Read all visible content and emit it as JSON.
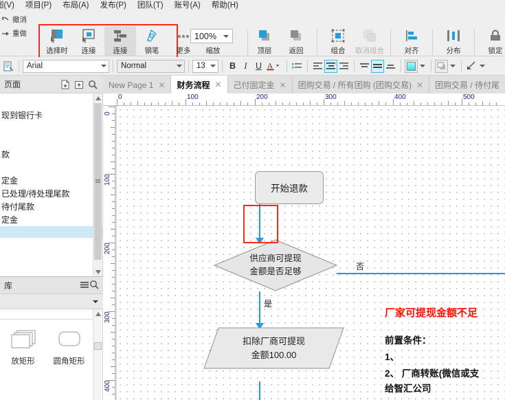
{
  "menubar": {
    "items": [
      "图(V)",
      "项目(P)",
      "布局(A)",
      "发布(P)",
      "团队(T)",
      "账号(A)",
      "帮助(H)"
    ]
  },
  "ribbon": {
    "undo_label": "撤消",
    "redo_label": "重做",
    "buttons": [
      {
        "label": "选择时",
        "icon": "select-tool-icon",
        "dim": false
      },
      {
        "label": "连接",
        "icon": "connector-icon",
        "dim": false
      },
      {
        "label": "钢笔",
        "icon": "pen-icon",
        "dim": false
      },
      {
        "label": "更多",
        "icon": "more-dots-icon",
        "dim": false
      }
    ],
    "zoom": {
      "value": "100%",
      "label": "缩放"
    },
    "arrange": [
      {
        "label": "顶层",
        "icon": "bring-to-front-icon",
        "dim": false
      },
      {
        "label": "返回",
        "icon": "send-to-back-icon",
        "dim": false
      },
      {
        "label": "组合",
        "icon": "group-icon",
        "dim": false
      },
      {
        "label": "取消组合",
        "icon": "ungroup-icon",
        "dim": true
      },
      {
        "label": "对齐",
        "icon": "align-icon",
        "dim": false
      },
      {
        "label": "分布",
        "icon": "distribute-icon",
        "dim": false
      },
      {
        "label": "锁定",
        "icon": "lock-icon",
        "dim": false
      }
    ]
  },
  "format_toolbar": {
    "style_icon": "text-style-icon",
    "font_family": "Arial",
    "font_style": "Normal",
    "font_size": "13",
    "bold": "B",
    "italic": "I",
    "underline": "U",
    "font_color_icon": "font-color-icon",
    "list_icon": "bullet-list-icon",
    "align_left_icon": "align-left-icon",
    "align_center_icon": "align-center-icon",
    "align_right_icon": "align-right-icon",
    "valign_top_icon": "valign-top-icon",
    "valign_middle_icon": "valign-middle-icon",
    "valign_bottom_icon": "valign-bottom-icon",
    "fill_color": "#3ff0f0",
    "shadow_icon": "shadow-icon",
    "line_icon": "line-style-icon"
  },
  "pages_panel": {
    "title": "页面",
    "add_page_icon": "add-page-icon",
    "add_folder_icon": "add-folder-icon",
    "search_icon": "search-icon",
    "items": [
      {
        "label": "现到银行卡",
        "selected": false,
        "editing": false
      },
      {
        "label": "",
        "selected": false,
        "editing": false
      },
      {
        "label": "款",
        "selected": false,
        "editing": false
      },
      {
        "label": "",
        "selected": false,
        "editing": false
      },
      {
        "label": "定金",
        "selected": false,
        "editing": false
      },
      {
        "label": "已处理/待处理尾款",
        "selected": false,
        "editing": false
      },
      {
        "label": "待付尾款",
        "selected": false,
        "editing": false
      },
      {
        "label": "定金",
        "selected": false,
        "editing": false
      },
      {
        "label": "",
        "selected": true,
        "editing": false
      },
      {
        "label": "",
        "selected": false,
        "editing": true
      }
    ]
  },
  "library_panel": {
    "title": "库",
    "menu_icon": "hamburger-icon",
    "search_icon": "search-icon",
    "dropdown_caret": "chevron-down-icon",
    "shapes": [
      {
        "label": "放矩形",
        "icon": "stacked-rect-icon"
      },
      {
        "label": "圆角矩形",
        "icon": "rounded-rect-icon"
      }
    ]
  },
  "tabs": [
    {
      "label": "New Page 1",
      "active": false,
      "closable": true
    },
    {
      "label": "财务流程",
      "active": true,
      "closable": true
    },
    {
      "label": "己付固定金",
      "active": false,
      "closable": true
    },
    {
      "label": "团购交易 / 所有团购 (团购交易)",
      "active": false,
      "closable": true
    },
    {
      "label": "团购交易 / 待付尾",
      "active": false,
      "closable": false
    }
  ],
  "rulers": {
    "horizontal_labels": [
      "0",
      "100",
      "200",
      "300",
      "400",
      "500"
    ],
    "vertical_labels": [
      "0",
      "100",
      "200",
      "300",
      "400"
    ]
  },
  "diagram": {
    "nodes": [
      {
        "id": "start",
        "type": "rounded-rect",
        "text": "开始退款"
      },
      {
        "id": "decision",
        "type": "diamond",
        "line1": "供应商可提现",
        "line2": "金额是否足够"
      },
      {
        "id": "deduct",
        "type": "parallelogram",
        "line1": "扣除厂商可提现",
        "line2": "金额100.00"
      }
    ],
    "edge_labels": [
      {
        "id": "no",
        "text": "否"
      },
      {
        "id": "yes",
        "text": "是"
      }
    ],
    "selection_highlight": "red-selection-box"
  },
  "annotations": {
    "title": "厂家可提现金额不足",
    "lines": [
      "前置条件：",
      "1、",
      "2、 厂商转账(微信或支",
      "给智汇公司"
    ]
  },
  "colors": {
    "connector": "#1f9ed4",
    "highlight": "#ff2a18",
    "note_red": "#ff1100",
    "selected_row": "#cfe8f6"
  }
}
